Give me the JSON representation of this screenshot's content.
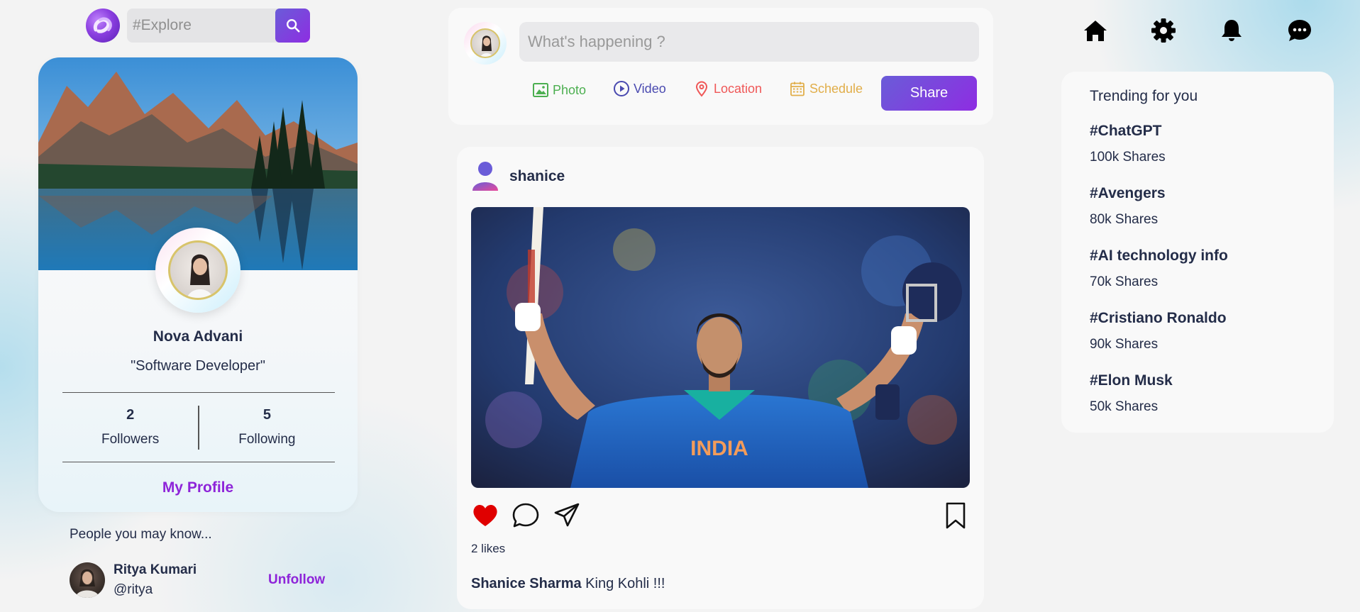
{
  "search": {
    "placeholder": "#Explore"
  },
  "profile": {
    "name": "Nova Advani",
    "role": "\"Software Developer\"",
    "followers_count": "2",
    "followers_label": "Followers",
    "following_count": "5",
    "following_label": "Following",
    "my_profile_label": "My Profile"
  },
  "suggestions": {
    "title": "People you may know...",
    "people": [
      {
        "name": "Ritya Kumari",
        "handle": "@ritya",
        "action": "Unfollow"
      }
    ]
  },
  "composer": {
    "placeholder": "What's happening ?",
    "options": [
      {
        "label": "Photo",
        "icon": "image-icon",
        "color": "#4caf50"
      },
      {
        "label": "Video",
        "icon": "play-circle-icon",
        "color": "#4a4ab0"
      },
      {
        "label": "Location",
        "icon": "location-pin-icon",
        "color": "#ef5757"
      },
      {
        "label": "Schedule",
        "icon": "calendar-icon",
        "color": "#e1ae4a"
      }
    ],
    "share_label": "Share"
  },
  "post": {
    "username": "shanice",
    "likes_text": "2 likes",
    "caption_author": "Shanice Sharma",
    "caption_text": " King Kohli !!!",
    "liked": true
  },
  "nav": {
    "icons": [
      "home-icon",
      "settings-gear-icon",
      "notification-bell-icon",
      "chat-bubble-icon"
    ]
  },
  "trending": {
    "title": "Trending for you",
    "items": [
      {
        "tag": "#ChatGPT",
        "shares": "100k Shares"
      },
      {
        "tag": "#Avengers",
        "shares": "80k Shares"
      },
      {
        "tag": "#AI technology info",
        "shares": "70k Shares"
      },
      {
        "tag": "#Cristiano Ronaldo",
        "shares": "90k Shares"
      },
      {
        "tag": "#Elon Musk",
        "shares": "50k Shares"
      }
    ]
  },
  "colors": {
    "accent_gradient_start": "#6a5cd8",
    "accent_gradient_end": "#8e2de2",
    "link_purple": "#8e24d9",
    "text_dark": "#242d49",
    "like_red": "#e00000"
  }
}
